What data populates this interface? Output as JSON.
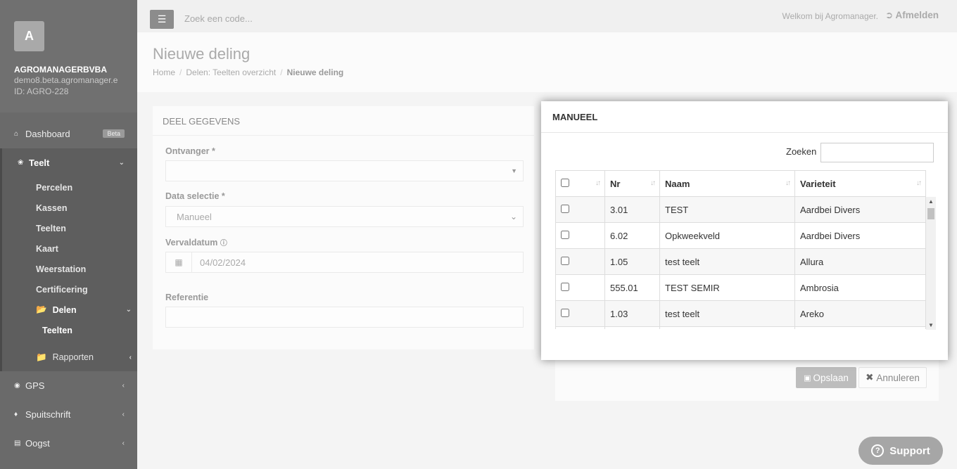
{
  "sidebar": {
    "avatar_letter": "A",
    "company": "AGROMANAGERBVBA",
    "domain": "demo8.beta.agromanager.e",
    "id_text": "ID: AGRO-228",
    "dashboard": "Dashboard",
    "beta": "Beta",
    "teelt": "Teelt",
    "teelt_items": [
      "Percelen",
      "Kassen",
      "Teelten",
      "Kaart",
      "Weerstation",
      "Certificering"
    ],
    "delen": "Delen",
    "delen_sub": "Teelten",
    "rapporten": "Rapporten",
    "gps": "GPS",
    "spuitschrift": "Spuitschrift",
    "oogst": "Oogst"
  },
  "topbar": {
    "search_placeholder": "Zoek een code...",
    "welcome": "Welkom bij Agromanager.",
    "logout": "Afmelden"
  },
  "page": {
    "title": "Nieuwe deling",
    "breadcrumb": [
      "Home",
      "Delen: Teelten overzicht",
      "Nieuwe deling"
    ]
  },
  "form": {
    "card_title": "DEEL GEGEVENS",
    "ontvanger_label": "Ontvanger *",
    "ontvanger_value": "",
    "data_selectie_label": "Data selectie *",
    "data_selectie_value": "Manueel",
    "vervaldatum_label": "Vervaldatum",
    "vervaldatum_value": "04/02/2024",
    "referentie_label": "Referentie",
    "referentie_value": ""
  },
  "actions": {
    "save": "Opslaan",
    "cancel": "Annuleren"
  },
  "modal": {
    "title": "MANUEEL",
    "search_label": "Zoeken",
    "columns": [
      "Nr",
      "Naam",
      "Varieteit"
    ],
    "rows": [
      {
        "nr": "3.01",
        "naam": "TEST",
        "varieteit": "Aardbei Divers"
      },
      {
        "nr": "6.02",
        "naam": "Opkweekveld",
        "varieteit": "Aardbei Divers"
      },
      {
        "nr": "1.05",
        "naam": "test teelt",
        "varieteit": "Allura"
      },
      {
        "nr": "555.01",
        "naam": "TEST SEMIR",
        "varieteit": "Ambrosia"
      },
      {
        "nr": "1.03",
        "naam": "test teelt",
        "varieteit": "Areko"
      }
    ]
  },
  "support": "Support"
}
